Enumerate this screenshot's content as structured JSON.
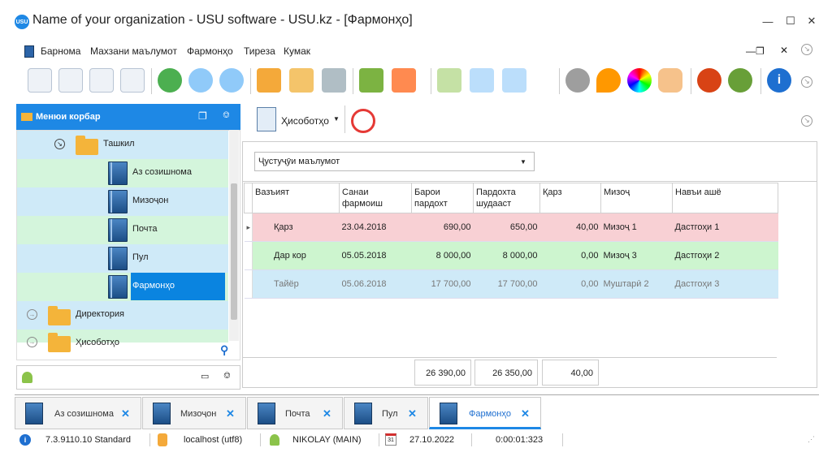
{
  "window": {
    "title": "Name of your organization - USU software - USU.kz - [Фармонҳо]",
    "logo_text": "USU"
  },
  "menu": [
    "Барнома",
    "Махзани маълумот",
    "Фармонҳо",
    "Тиреза",
    "Кумак"
  ],
  "side_panel": {
    "title": "Менюи корбар",
    "tree": [
      {
        "label": "Ташкил",
        "type": "folder-open"
      },
      {
        "label": "Аз созишнома",
        "type": "book"
      },
      {
        "label": "Мизоҷон",
        "type": "book"
      },
      {
        "label": "Почта",
        "type": "book"
      },
      {
        "label": "Пул",
        "type": "book"
      },
      {
        "label": "Фармонҳо",
        "type": "book",
        "selected": true
      },
      {
        "label": "Директория",
        "type": "folder"
      },
      {
        "label": "Ҳисоботҳо",
        "type": "folder"
      }
    ]
  },
  "main": {
    "reports_label": "Ҳисоботҳо",
    "status_select_value": "Ҷустуҷӯи маълумот",
    "columns": [
      "Вазъият",
      "Санаи фармоиш",
      "Барои пардохт",
      "Пардохта шудааст",
      "Қарз",
      "Мизоҷ",
      "Навъи ашё"
    ],
    "rows": [
      {
        "status": "Қарз",
        "date": "23.04.2018",
        "to_pay": "690,00",
        "paid": "650,00",
        "debt": "40,00",
        "client": "Мизоҷ 1",
        "item_type": "Дастгоҳи 1",
        "bg": "#f8d0d4",
        "color": "#222"
      },
      {
        "status": "Дар кор",
        "date": "05.05.2018",
        "to_pay": "8 000,00",
        "paid": "8 000,00",
        "debt": "0,00",
        "client": "Мизоҷ 3",
        "item_type": "Дастгоҳи 2",
        "bg": "#cdf5cf",
        "color": "#222"
      },
      {
        "status": "Тайёр",
        "date": "05.06.2018",
        "to_pay": "17 700,00",
        "paid": "17 700,00",
        "debt": "0,00",
        "client": "Муштарӣ 2",
        "item_type": "Дастгоҳи 3",
        "bg": "#cfeaf8",
        "color": "#777"
      }
    ],
    "totals": {
      "to_pay": "26 390,00",
      "paid": "26 350,00",
      "debt": "40,00"
    }
  },
  "tabs": [
    {
      "label": "Аз созишнома"
    },
    {
      "label": "Мизоҷон"
    },
    {
      "label": "Почта"
    },
    {
      "label": "Пул"
    },
    {
      "label": "Фармонҳо",
      "active": true
    }
  ],
  "status_bar": {
    "version": "7.3.9110.10 Standard",
    "db": "localhost (utf8)",
    "user": "NIKOLAY (MAIN)",
    "calendar_day": "31",
    "date": "27.10.2022",
    "timer": "0:00:01:323"
  },
  "colors": {
    "accent": "#1e88e5"
  }
}
